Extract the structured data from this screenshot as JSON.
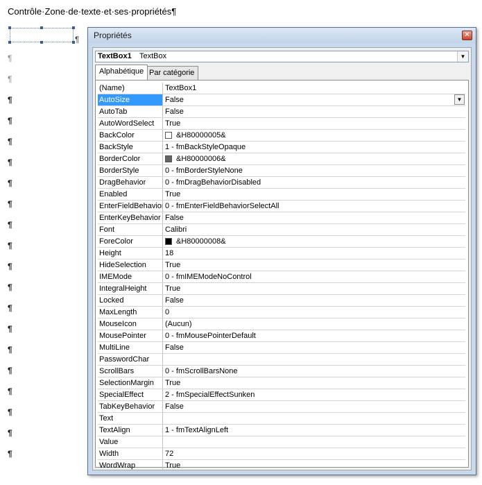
{
  "document": {
    "heading": "Contrôle·Zone·de·texte·et·ses·propriétés¶",
    "pilcrow": "¶"
  },
  "window": {
    "title": "Propriétés",
    "close_glyph": "✕"
  },
  "object_selector": {
    "name": "TextBox1",
    "type": "TextBox"
  },
  "tabs": [
    {
      "label": "Alphabétique",
      "active": true
    },
    {
      "label": "Par catégorie",
      "active": false
    }
  ],
  "properties": [
    {
      "name": "(Name)",
      "value": "TextBox1"
    },
    {
      "name": "AutoSize",
      "value": "False",
      "selected": true
    },
    {
      "name": "AutoTab",
      "value": "False"
    },
    {
      "name": "AutoWordSelect",
      "value": "True"
    },
    {
      "name": "BackColor",
      "value": "&H80000005&",
      "swatch": "#ffffff"
    },
    {
      "name": "BackStyle",
      "value": "1 - fmBackStyleOpaque"
    },
    {
      "name": "BorderColor",
      "value": "&H80000006&",
      "swatch": "#646464"
    },
    {
      "name": "BorderStyle",
      "value": "0 - fmBorderStyleNone"
    },
    {
      "name": "DragBehavior",
      "value": "0 - fmDragBehaviorDisabled"
    },
    {
      "name": "Enabled",
      "value": "True"
    },
    {
      "name": "EnterFieldBehavior",
      "value": "0 - fmEnterFieldBehaviorSelectAll"
    },
    {
      "name": "EnterKeyBehavior",
      "value": "False"
    },
    {
      "name": "Font",
      "value": "Calibri"
    },
    {
      "name": "ForeColor",
      "value": "&H80000008&",
      "swatch": "#000000"
    },
    {
      "name": "Height",
      "value": "18"
    },
    {
      "name": "HideSelection",
      "value": "True"
    },
    {
      "name": "IMEMode",
      "value": "0 - fmIMEModeNoControl"
    },
    {
      "name": "IntegralHeight",
      "value": "True"
    },
    {
      "name": "Locked",
      "value": "False"
    },
    {
      "name": "MaxLength",
      "value": "0"
    },
    {
      "name": "MouseIcon",
      "value": "(Aucun)"
    },
    {
      "name": "MousePointer",
      "value": "0 - fmMousePointerDefault"
    },
    {
      "name": "MultiLine",
      "value": "False"
    },
    {
      "name": "PasswordChar",
      "value": ""
    },
    {
      "name": "ScrollBars",
      "value": "0 - fmScrollBarsNone"
    },
    {
      "name": "SelectionMargin",
      "value": "True"
    },
    {
      "name": "SpecialEffect",
      "value": "2 - fmSpecialEffectSunken"
    },
    {
      "name": "TabKeyBehavior",
      "value": "False"
    },
    {
      "name": "Text",
      "value": ""
    },
    {
      "name": "TextAlign",
      "value": "1 - fmTextAlignLeft"
    },
    {
      "name": "Value",
      "value": ""
    },
    {
      "name": "Width",
      "value": "72"
    },
    {
      "name": "WordWrap",
      "value": "True"
    }
  ],
  "colors": {
    "selection": "#3399ff",
    "window_frame": "#c9d9ec"
  },
  "icons": {
    "close": "close-icon",
    "dropdown": "chevron-down-icon"
  }
}
